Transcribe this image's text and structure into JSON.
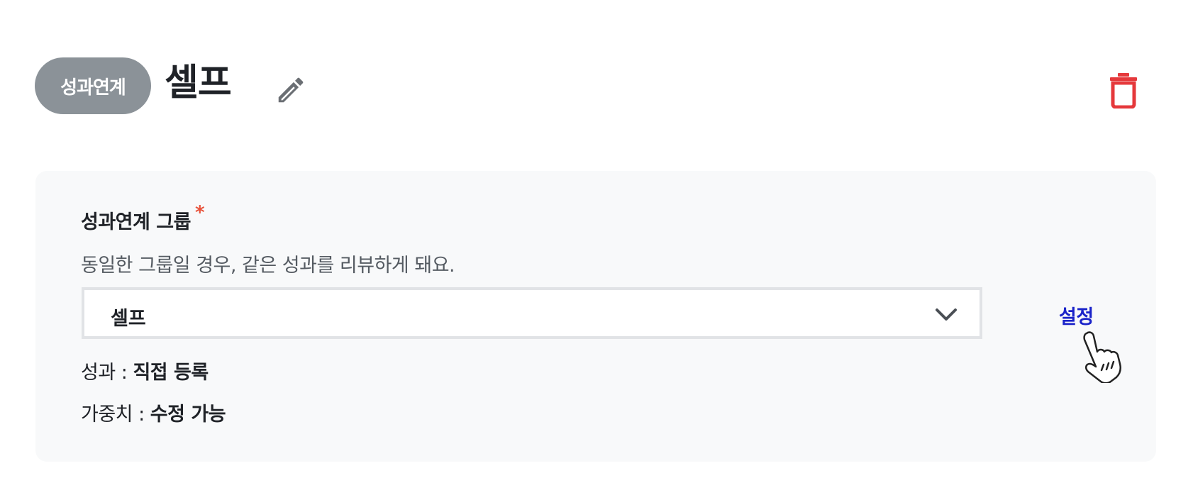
{
  "header": {
    "tag_label": "성과연계",
    "title": "셀프"
  },
  "group": {
    "label": "성과연계 그룹",
    "required_mark": "*",
    "description": "동일한 그룹일 경우, 같은 성과를 리뷰하게 돼요.",
    "selected_value": "셀프",
    "settings_label": "설정"
  },
  "info": {
    "performance_key": "성과 : ",
    "performance_value": "직접 등록",
    "weight_key": "가중치 : ",
    "weight_value": "수정 가능"
  },
  "icons": {
    "edit": "pencil-icon",
    "delete": "trash-icon",
    "dropdown": "chevron-down-icon",
    "cursor": "hand-pointer-icon"
  },
  "colors": {
    "tag_bg": "#8b9298",
    "delete": "#e5383b",
    "link": "#1a23c9",
    "required": "#e8533b",
    "card_bg": "#f8f9fa"
  }
}
